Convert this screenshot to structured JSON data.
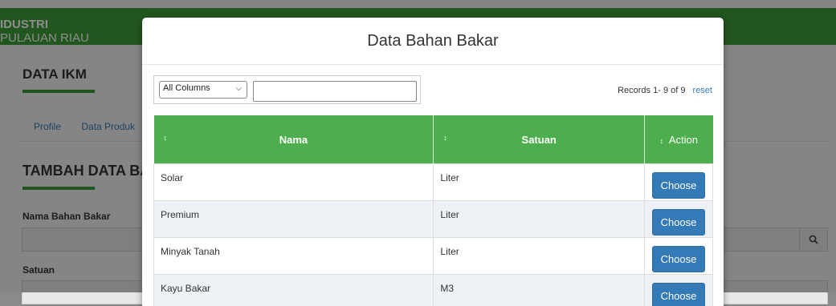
{
  "background": {
    "brand_line1": "IDUSTRI",
    "brand_line2": "PULAUAN RIAU",
    "page_title": "DATA IKM",
    "tabs": [
      "Profile",
      "Data Produk"
    ],
    "section_title": "TAMBAH DATA BA",
    "field1_label": "Nama Bahan Bakar",
    "field2_label": "Satuan"
  },
  "modal": {
    "title": "Data Bahan Bakar",
    "column_select": "All Columns",
    "search_value": "",
    "records_text": "Records 1- 9 of 9",
    "reset_label": "reset",
    "headers": {
      "nama": "Nama",
      "satuan": "Satuan",
      "action": "Action"
    },
    "sort_glyph": "↕",
    "rows": [
      {
        "nama": "Solar",
        "satuan": "Liter",
        "action": "Choose"
      },
      {
        "nama": "Premium",
        "satuan": "Liter",
        "action": "Choose"
      },
      {
        "nama": "Minyak Tanah",
        "satuan": "Liter",
        "action": "Choose"
      },
      {
        "nama": "Kayu Bakar",
        "satuan": "M3",
        "action": "Choose"
      }
    ]
  },
  "colors": {
    "header_green": "#4cae4c",
    "button_blue": "#337ab7",
    "topbar_green": "#3f9d3a"
  }
}
